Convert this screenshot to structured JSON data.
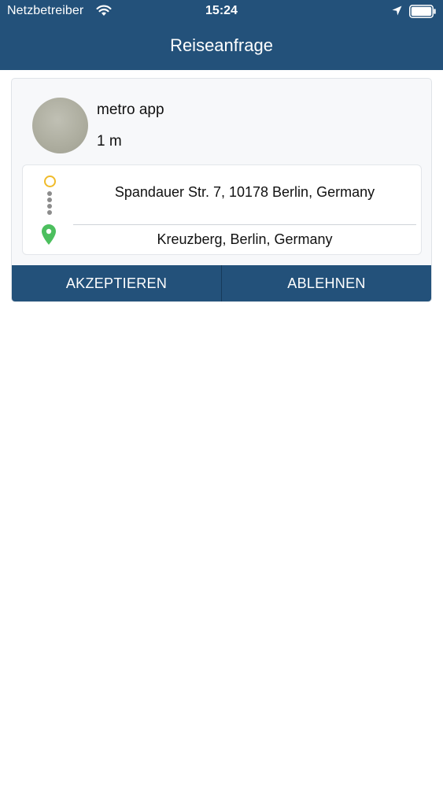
{
  "status_bar": {
    "carrier": "Netzbetreiber",
    "time": "15:24",
    "wifi_icon": "wifi-icon",
    "location_icon": "location-arrow-icon",
    "battery_icon": "battery-icon"
  },
  "nav": {
    "title": "Reiseanfrage"
  },
  "request": {
    "rider_name": "metro app",
    "eta": "1 m",
    "pickup_address": "Spandauer Str. 7, 10178 Berlin, Germany",
    "dropoff_address": "Kreuzberg, Berlin, Germany"
  },
  "actions": {
    "accept_label": "AKZEPTIEREN",
    "decline_label": "ABLEHNEN"
  },
  "colors": {
    "primary": "#23517a",
    "pickup_marker": "#f0bb2a",
    "dropoff_marker": "#4cbf5e"
  }
}
